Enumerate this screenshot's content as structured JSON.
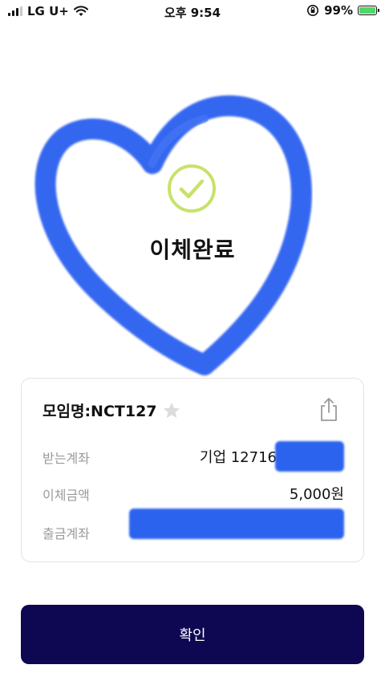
{
  "status_bar": {
    "carrier": "LG U+",
    "time": "오후 9:54",
    "battery": "99%"
  },
  "result": {
    "title": "이체완료"
  },
  "card": {
    "group_name": "모임명:NCT127",
    "rows": [
      {
        "label": "받는계좌",
        "value": "기업 12716"
      },
      {
        "label": "이체금액",
        "value": "5,000원"
      },
      {
        "label": "출금계좌",
        "value": ""
      }
    ]
  },
  "confirm_label": "확인",
  "colors": {
    "heart": "#2b5ff0",
    "check": "#c8e26a",
    "button": "#0e0852",
    "redaction": "#2b63ee"
  },
  "icons": [
    "signal-icon",
    "wifi-icon",
    "rotation-lock-icon",
    "battery-icon",
    "check-circle-icon",
    "star-icon",
    "share-icon"
  ]
}
